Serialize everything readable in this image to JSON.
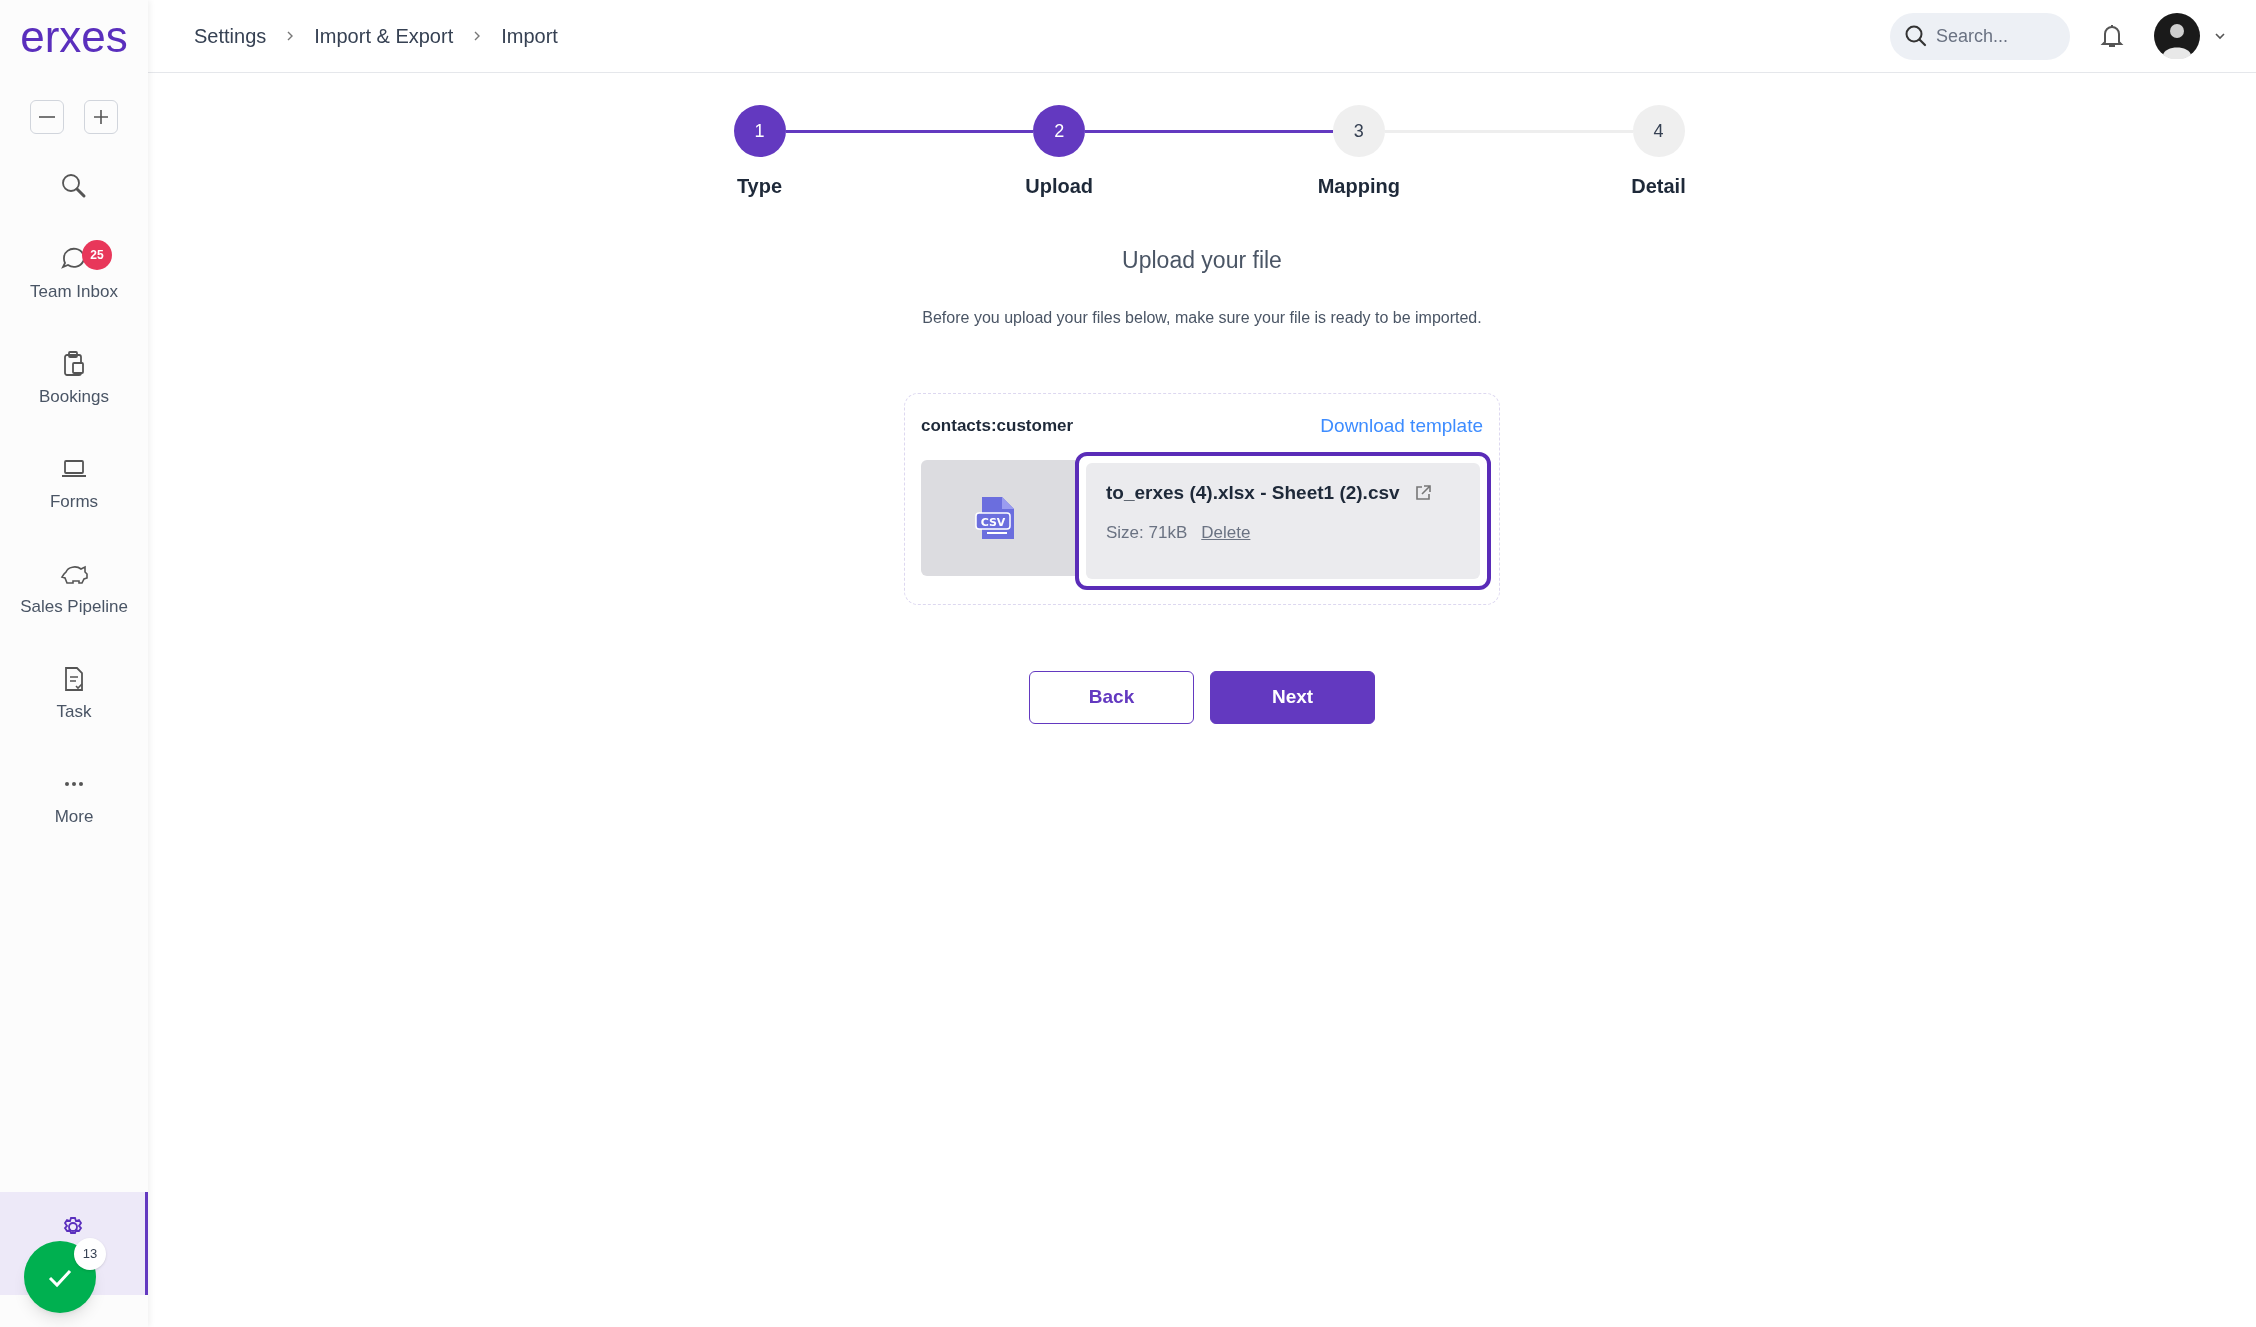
{
  "logo": "erxes",
  "sidebar": {
    "items": [
      {
        "label": "Team Inbox",
        "badge": "25",
        "selected": false
      },
      {
        "label": "Bookings",
        "selected": false
      },
      {
        "label": "Forms",
        "selected": false
      },
      {
        "label": "Sales Pipeline",
        "selected": false
      },
      {
        "label": "Task",
        "selected": false
      },
      {
        "label": "More",
        "selected": false
      },
      {
        "selected": true
      }
    ]
  },
  "floating_button": {
    "badge": "13"
  },
  "breadcrumb": [
    "Settings",
    "Import & Export",
    "Import"
  ],
  "search": {
    "placeholder": "Search..."
  },
  "steps": [
    {
      "number": "1",
      "label": "Type",
      "done": true
    },
    {
      "number": "2",
      "label": "Upload",
      "done": true
    },
    {
      "number": "3",
      "label": "Mapping",
      "done": false
    },
    {
      "number": "4",
      "label": "Detail",
      "done": false
    }
  ],
  "title": "Upload your file",
  "description": "Before you upload your files below, make sure your file is ready to be imported.",
  "upload_card": {
    "type": "contacts:customer",
    "download_link": "Download template",
    "file_type_label": "CSV",
    "file_name": "to_erxes (4).xlsx - Sheet1 (2).csv",
    "size": "Size: 71kB",
    "delete_link": "Delete"
  },
  "buttons": [
    {
      "label": "Back",
      "kind": "secondary"
    },
    {
      "label": "Next",
      "kind": "primary"
    }
  ]
}
